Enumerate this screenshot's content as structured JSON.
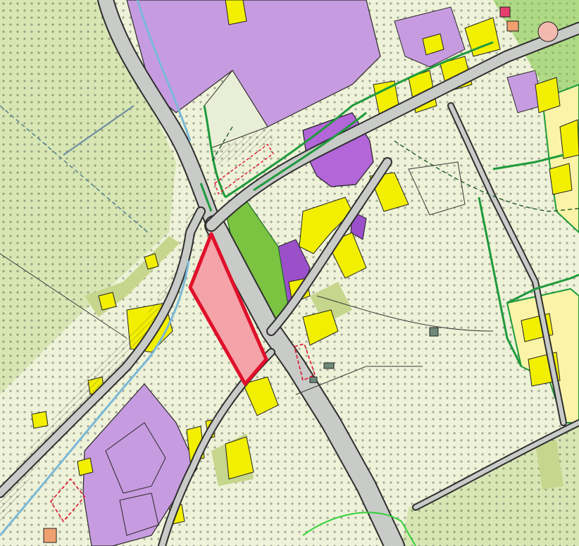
{
  "map": {
    "kind": "zoning-plan",
    "labels": [],
    "highlighted_parcel": {
      "outline_color": "#e0102a",
      "fill_color": "#f4a3a8"
    },
    "legend_colors": {
      "open_land": "#eef2d8",
      "agricultural": "#d8e6b4",
      "industrial": "#c79be0",
      "industrial_dark": "#9b4fc9",
      "residential": "#f2f000",
      "residential_pale": "#fbf4a8",
      "green_space": "#7bc442",
      "road_surface": "#c9cbc8",
      "road_edge": "#2e2e2e",
      "green_boundary": "#1e9a3c",
      "grey_green": "#c6d68c",
      "waterway": "#7bb8d8"
    }
  }
}
